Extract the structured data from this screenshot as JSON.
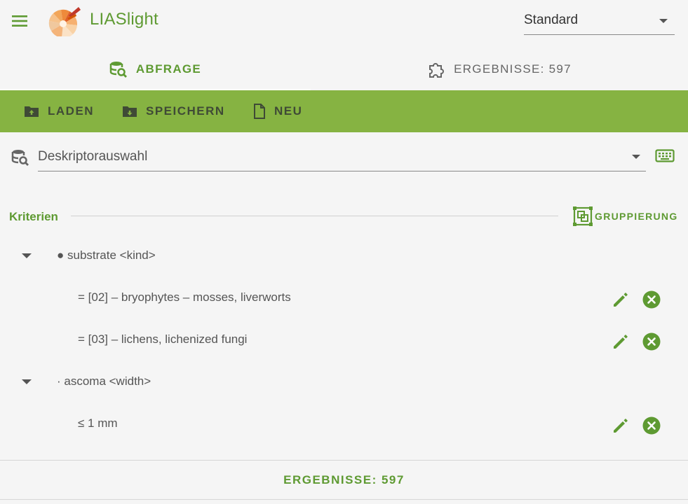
{
  "app": {
    "title": "LIASlight"
  },
  "preset": {
    "value": "Standard"
  },
  "tabs": [
    {
      "label": "ABFRAGE",
      "icon": "database-search-icon",
      "active": true
    },
    {
      "label": "ERGEBNISSE: 597",
      "icon": "puzzle-icon",
      "active": false
    }
  ],
  "toolbar": {
    "load_label": "LADEN",
    "save_label": "SPEICHERN",
    "new_label": "NEU"
  },
  "descriptor": {
    "value": "Deskriptorauswahl"
  },
  "criteria": {
    "title": "Kriterien",
    "group_label": "GRUPPIERUNG",
    "rows": [
      {
        "text": "● substrate <kind>",
        "type": "group"
      },
      {
        "text": "= [02] – bryophytes – mosses, liverworts",
        "type": "value"
      },
      {
        "text": "= [03] – lichens, lichenized fungi",
        "type": "value"
      },
      {
        "text": "· ascoma <width>",
        "type": "group"
      },
      {
        "text": "≤ 1 mm",
        "type": "value"
      }
    ]
  },
  "footer": {
    "label": "ERGEBNISSE: 597"
  },
  "colors": {
    "accent": "#5e9a32",
    "toolbar": "#86b342",
    "background": "#f5f5f5"
  }
}
